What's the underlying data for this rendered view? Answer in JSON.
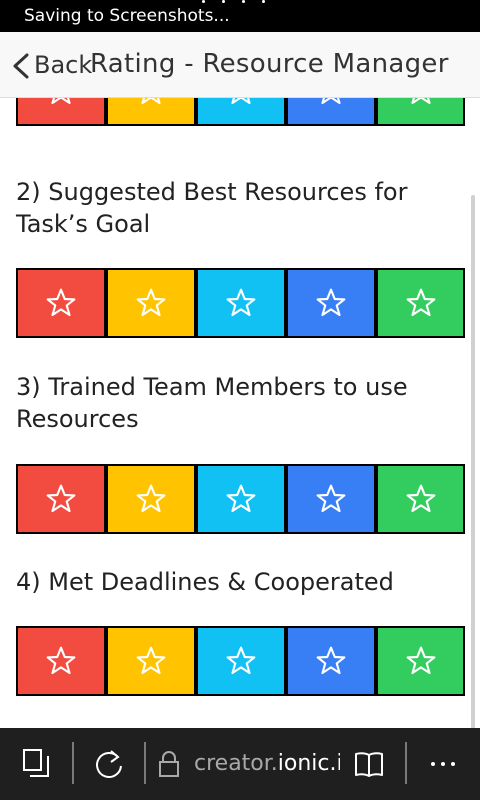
{
  "status": {
    "text": "Saving to Screenshots..."
  },
  "header": {
    "back_label": "Back",
    "title": "Rating - Resource Manager"
  },
  "questions": [
    {
      "label": "2) Suggested Best Resources for Task’s Goal"
    },
    {
      "label": "3) Trained Team Members to use Resources"
    },
    {
      "label": "4) Met Deadlines & Cooperated"
    }
  ],
  "rating_scale": {
    "star_icon": "star-outline-icon",
    "colors": [
      "#f24b3f",
      "#ffc300",
      "#11c1f3",
      "#387ef5",
      "#33cd5f"
    ]
  },
  "browser": {
    "url_prefix": "creator.",
    "url_host": "ionic.io",
    "icons": [
      "tabs-icon",
      "refresh-icon",
      "lock-icon",
      "reading-view-icon",
      "more-icon"
    ]
  }
}
